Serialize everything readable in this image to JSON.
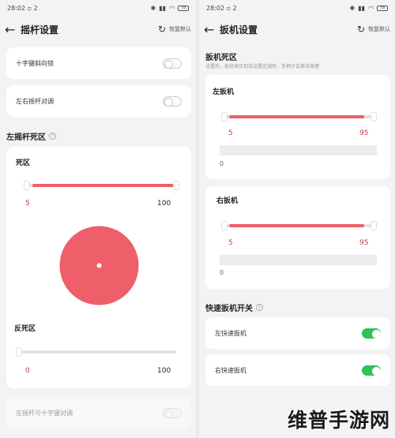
{
  "left": {
    "status": {
      "time": "28:02",
      "badge": "2",
      "battery": "78"
    },
    "header": {
      "title": "摇杆设置",
      "reset_label": "恢复默认"
    },
    "toggles": [
      {
        "label": "十字键斜向锁",
        "on": false
      },
      {
        "label": "左右摇杆对调",
        "on": false
      }
    ],
    "deadzone_section_title": "左摇杆死区",
    "deadzone": {
      "label": "死区",
      "min_value": "5",
      "max_value": "100"
    },
    "anti_deadzone": {
      "label": "反死区",
      "min_value": "0",
      "max_value": "100"
    },
    "bottom_toggle": {
      "label": "左摇杆与十字键对调",
      "on": false
    }
  },
  "right": {
    "status": {
      "time": "28:02",
      "badge": "2",
      "battery": "78"
    },
    "header": {
      "title": "扳机设置",
      "reset_label": "恢复默认"
    },
    "deadzone_section_title": "扳机死区",
    "deadzone_desc": "设置后，扳机按压到该设置区域时，手柄才会激活按键",
    "left_trigger": {
      "label": "左扳机",
      "min_value": "5",
      "max_value": "95",
      "current": "0"
    },
    "right_trigger": {
      "label": "右扳机",
      "min_value": "5",
      "max_value": "95",
      "current": "0"
    },
    "quick_section_title": "快速扳机开关",
    "quick_toggles": [
      {
        "label": "左快速扳机",
        "on": true
      },
      {
        "label": "右快速扳机",
        "on": true
      }
    ]
  },
  "watermark": "维普手游网",
  "colors": {
    "accent_red": "#ee5f69",
    "toggle_on": "#2fc15a"
  }
}
